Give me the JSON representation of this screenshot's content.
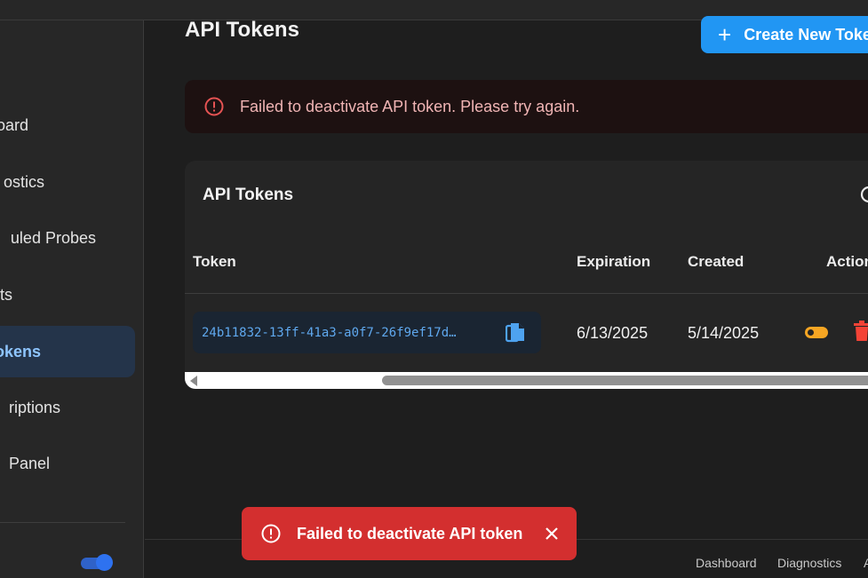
{
  "sidebar": {
    "items": [
      {
        "label": "oard",
        "active": false
      },
      {
        "label": "ostics",
        "active": false
      },
      {
        "label": "uled Probes",
        "active": false
      },
      {
        "label": "ts",
        "active": false
      },
      {
        "label": "okens",
        "active": true
      },
      {
        "label": "riptions",
        "active": false
      },
      {
        "label": "Panel",
        "active": false
      }
    ],
    "theme_toggle": {
      "state": "on",
      "color": "#2e72f0"
    }
  },
  "main": {
    "page_title": "API Tokens",
    "create_button": {
      "label": "Create New Toke",
      "icon": "plus-icon",
      "color": "#2196f3"
    },
    "alert": {
      "message": "Failed to deactivate API token. Please try again.",
      "icon": "error-circle-icon"
    },
    "card": {
      "title": "API Tokens",
      "search_icon": "search-icon",
      "columns": [
        "Token",
        "Expiration",
        "Created",
        "Action"
      ],
      "rows": [
        {
          "token": "24b11832-13ff-41a3-a0f7-26f9ef17d…",
          "expiration": "6/13/2025",
          "created": "5/14/2025",
          "actions": [
            "toggle-icon",
            "trash-icon"
          ]
        }
      ]
    }
  },
  "footer": {
    "links": [
      "Dashboard",
      "Diagnostics",
      "A"
    ]
  },
  "toast": {
    "message": "Failed to deactivate API token",
    "icon": "error-circle-icon",
    "close_icon": "close-icon",
    "color": "#d32f2f"
  },
  "colors": {
    "accent": "#2196f3",
    "error": "#d32f2f",
    "warning_toggle": "#f6a623",
    "link": "#5fa8ee"
  }
}
